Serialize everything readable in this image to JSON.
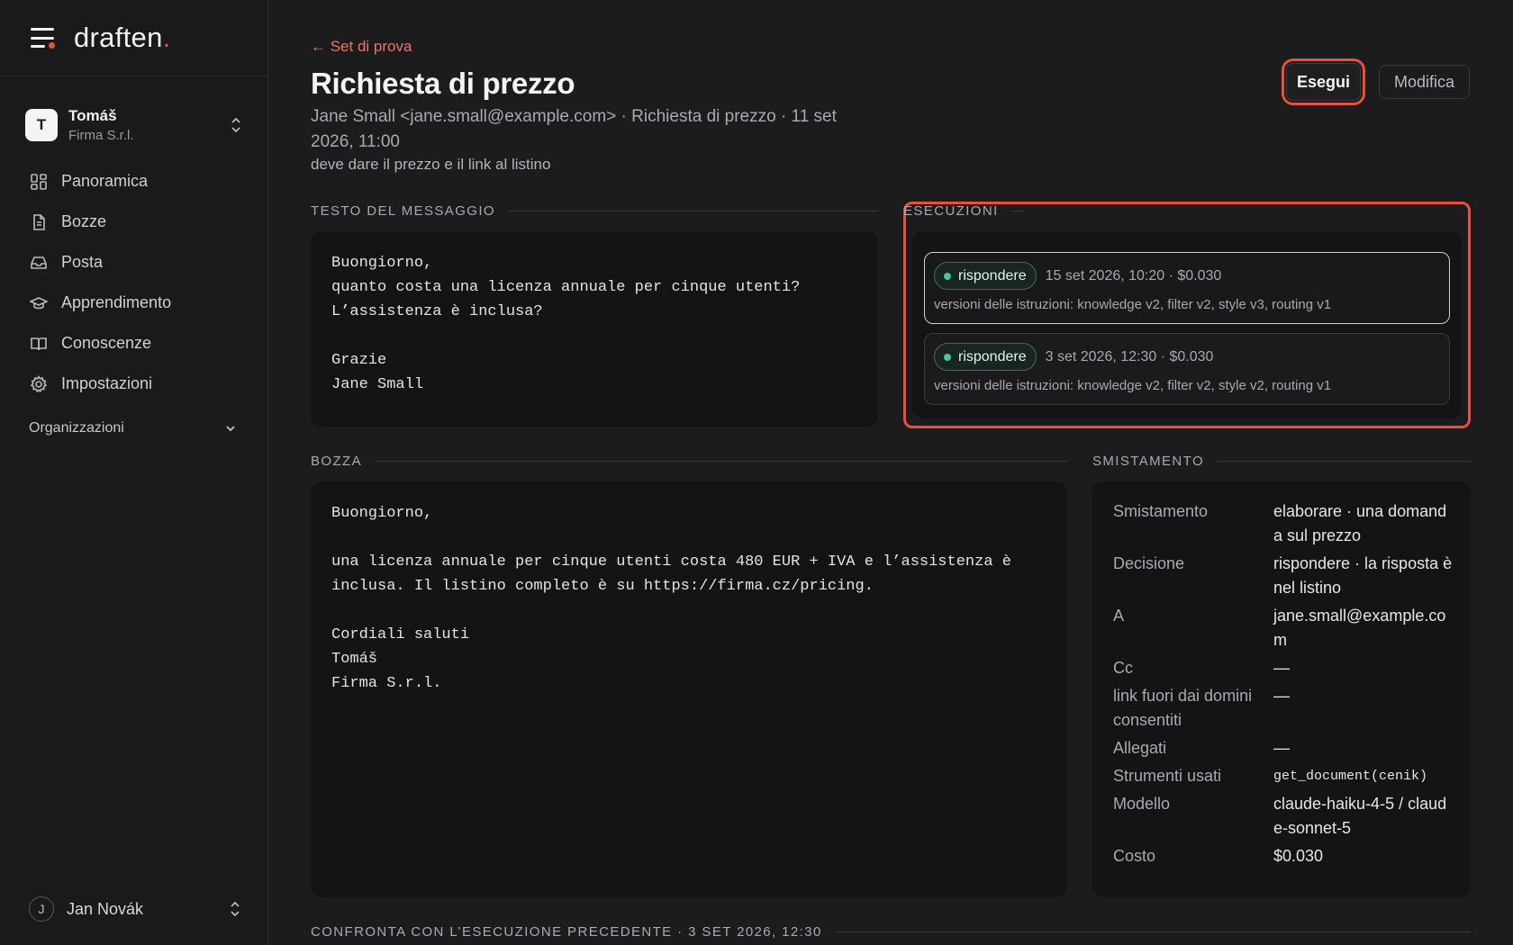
{
  "brand": {
    "logo": "draften",
    "logo_dot": "."
  },
  "org": {
    "initial": "T",
    "name": "Tomáš",
    "company": "Firma S.r.l."
  },
  "nav": {
    "items": [
      {
        "label": "Panoramica",
        "icon": "grid-icon"
      },
      {
        "label": "Bozze",
        "icon": "document-icon"
      },
      {
        "label": "Posta",
        "icon": "inbox-icon"
      },
      {
        "label": "Apprendimento",
        "icon": "graduation-cap-icon"
      },
      {
        "label": "Conoscenze",
        "icon": "book-icon"
      },
      {
        "label": "Impostazioni",
        "icon": "gear-icon"
      }
    ],
    "organizations_label": "Organizzazioni"
  },
  "user": {
    "initial": "J",
    "name": "Jan Novák"
  },
  "header": {
    "back_label": "← Set di prova",
    "title": "Richiesta di prezzo",
    "meta": "Jane Small <jane.small@example.com> · Richiesta di prezzo · 11 set 2026, 11:00",
    "note": "deve dare il prezzo e il link al listino",
    "run_button": "Esegui",
    "edit_button": "Modifica"
  },
  "message": {
    "heading": "TESTO DEL MESSAGGIO",
    "body": "Buongiorno,\nquanto costa una licenza annuale per cinque utenti?\nL’assistenza è inclusa?\n\nGrazie\nJane Small"
  },
  "runs": {
    "heading": "ESECUZIONI",
    "items": [
      {
        "status": "rispondere",
        "meta": "15 set 2026, 10:20 · $0.030",
        "versions": "versioni delle istruzioni: knowledge v2, filter v2, style v3, routing v1"
      },
      {
        "status": "rispondere",
        "meta": "3 set 2026, 12:30 · $0.030",
        "versions": "versioni delle istruzioni: knowledge v2, filter v2, style v2, routing v1"
      }
    ]
  },
  "draft": {
    "heading": "BOZZA",
    "body": "Buongiorno,\n\nuna licenza annuale per cinque utenti costa 480 EUR + IVA e l’assistenza è\ninclusa. Il listino completo è su https://firma.cz/pricing.\n\nCordiali saluti\nTomáš\nFirma S.r.l."
  },
  "routing": {
    "heading": "SMISTAMENTO",
    "rows": [
      {
        "key": "Smistamento",
        "value": "elaborare · una domanda sul prezzo"
      },
      {
        "key": "Decisione",
        "value": "rispondere · la risposta è nel listino"
      },
      {
        "key": "A",
        "value": "jane.small@example.com"
      },
      {
        "key": "Cc",
        "value": "—"
      },
      {
        "key": "link fuori dai domini consentiti",
        "value": "—"
      },
      {
        "key": "Allegati",
        "value": "—"
      },
      {
        "key": "Strumenti usati",
        "value": "get_document(cenik)"
      },
      {
        "key": "Modello",
        "value": "claude-haiku-4-5 / claude-sonnet-5"
      },
      {
        "key": "Costo",
        "value": "$0.030"
      }
    ]
  },
  "compare": {
    "heading": "CONFRONTA CON L’ESECUZIONE PRECEDENTE · 3 SET 2026, 12:30"
  },
  "colors": {
    "accent": "#e8503a",
    "status_green": "#4cc59b"
  }
}
